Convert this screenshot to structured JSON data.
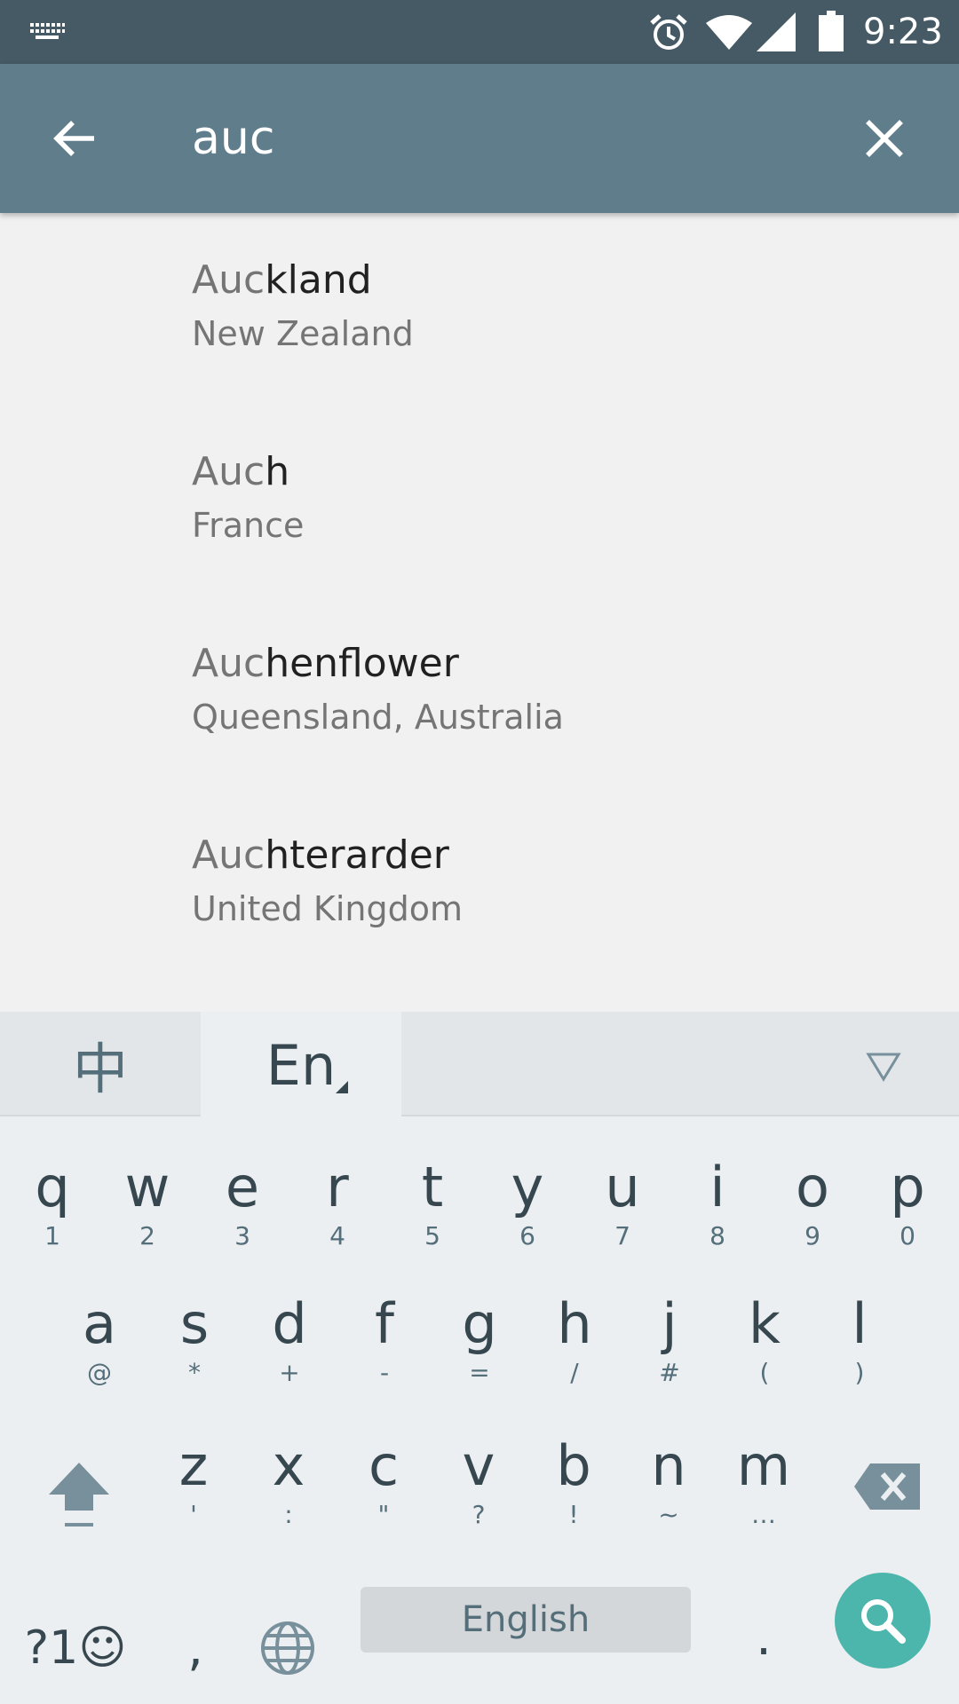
{
  "status_bar": {
    "time": "9:23",
    "icons": [
      "keyboard-icon",
      "alarm-icon",
      "wifi-icon",
      "signal-icon",
      "battery-icon"
    ]
  },
  "search": {
    "query": "auc",
    "back_icon": "arrow-back-icon",
    "clear_icon": "close-icon"
  },
  "results": [
    {
      "match": "Auc",
      "rest": "kland",
      "region": "New Zealand"
    },
    {
      "match": "Auc",
      "rest": "h",
      "region": "France"
    },
    {
      "match": "Auc",
      "rest": "henflower",
      "region": "Queensland, Australia"
    },
    {
      "match": "Auc",
      "rest": "hterarder",
      "region": "United Kingdom"
    }
  ],
  "keyboard": {
    "tabs": {
      "chinese": "中",
      "english": "En"
    },
    "row1": [
      {
        "main": "q",
        "sub": "1"
      },
      {
        "main": "w",
        "sub": "2"
      },
      {
        "main": "e",
        "sub": "3"
      },
      {
        "main": "r",
        "sub": "4"
      },
      {
        "main": "t",
        "sub": "5"
      },
      {
        "main": "y",
        "sub": "6"
      },
      {
        "main": "u",
        "sub": "7"
      },
      {
        "main": "i",
        "sub": "8"
      },
      {
        "main": "o",
        "sub": "9"
      },
      {
        "main": "p",
        "sub": "0"
      }
    ],
    "row2": [
      {
        "main": "a",
        "sub": "@"
      },
      {
        "main": "s",
        "sub": "*"
      },
      {
        "main": "d",
        "sub": "+"
      },
      {
        "main": "f",
        "sub": "-"
      },
      {
        "main": "g",
        "sub": "="
      },
      {
        "main": "h",
        "sub": "/"
      },
      {
        "main": "j",
        "sub": "#"
      },
      {
        "main": "k",
        "sub": "("
      },
      {
        "main": "l",
        "sub": ")"
      }
    ],
    "row3": [
      {
        "main": "z",
        "sub": "'"
      },
      {
        "main": "x",
        "sub": ":"
      },
      {
        "main": "c",
        "sub": "\""
      },
      {
        "main": "v",
        "sub": "?"
      },
      {
        "main": "b",
        "sub": "!"
      },
      {
        "main": "n",
        "sub": "~"
      },
      {
        "main": "m",
        "sub": "…"
      }
    ],
    "symbols_label": "?1☺",
    "comma_label": ",",
    "space_label": "English",
    "period_label": ".",
    "accent_color": "#4db6ac"
  }
}
